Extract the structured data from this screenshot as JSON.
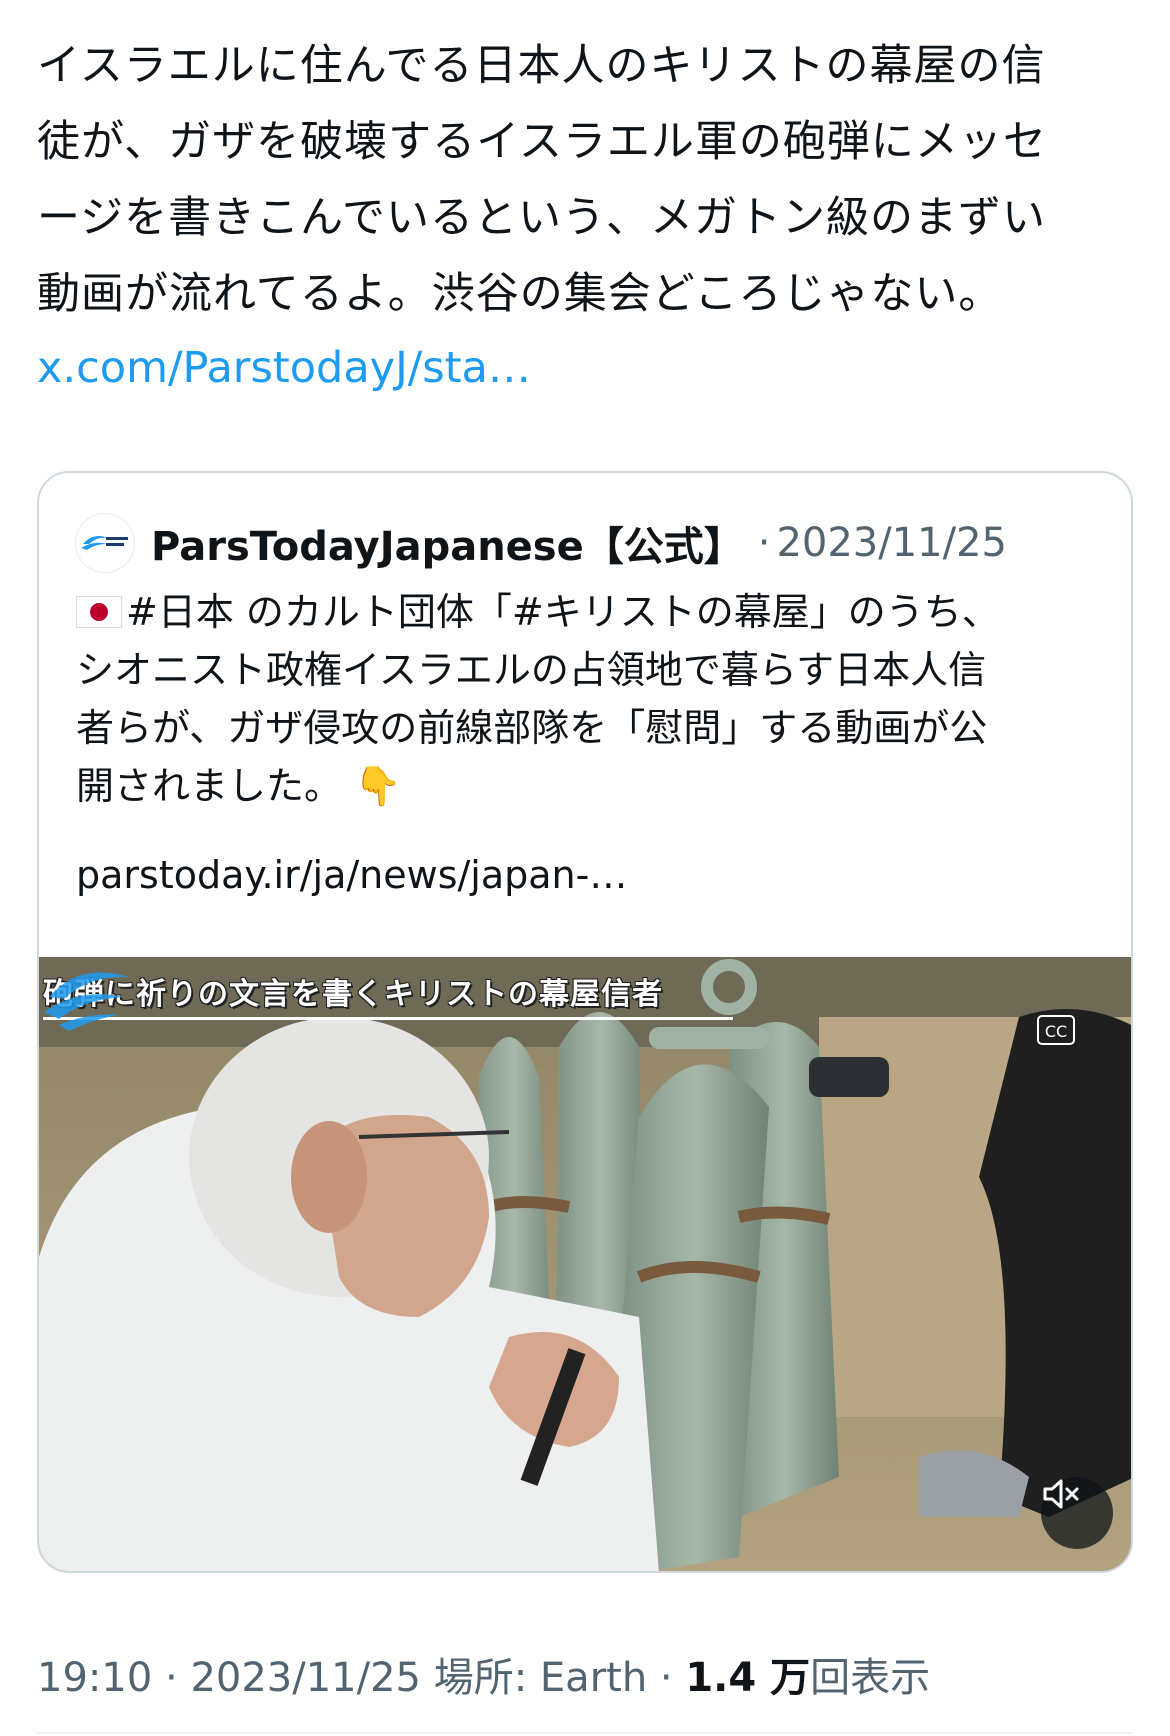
{
  "tweet": {
    "text": "イスラエルに住んでる日本人のキリストの幕屋の信\n徒が、ガザを破壊するイスラエル軍の砲弾にメッセ\nージを書きこんでいるという、メガトン級のまずい\n動画が流れてるよ。渋谷の集会どころじゃない。",
    "link": "x.com/ParstodayJ/sta…"
  },
  "quote": {
    "avatar_label": "ParsToday Japanese",
    "author": "ParsTodayJapanese【公式】",
    "separator": "·",
    "date": "2023/11/25",
    "text": "#日本 のカルト団体「#キリストの幕屋」のうち、\nシオニスト政権イスラエルの占領地で暮らす日本人信\n者らが、ガザ侵攻の前線部隊を「慰問」する動画が公\n開されました。 👇",
    "url": "parstoday.ir/ja/news/japan-…",
    "flag_icon": "japan-flag-icon"
  },
  "media": {
    "caption": "砲弾に祈りの文言を書くキリストの幕屋信者",
    "watermark": "ParsToday Japanese",
    "cc_label": "CC",
    "mute_icon": "muted-speaker-icon"
  },
  "meta": {
    "time": "19:10",
    "date": "2023/11/25",
    "location_label": "場所:",
    "location": "Earth",
    "views_count": "1.4 万",
    "views_label": "回表示",
    "separator": "·"
  },
  "colors": {
    "text": "#0f1419",
    "secondary": "#536471",
    "link": "#1d9bf0",
    "border": "#cfd9de"
  }
}
